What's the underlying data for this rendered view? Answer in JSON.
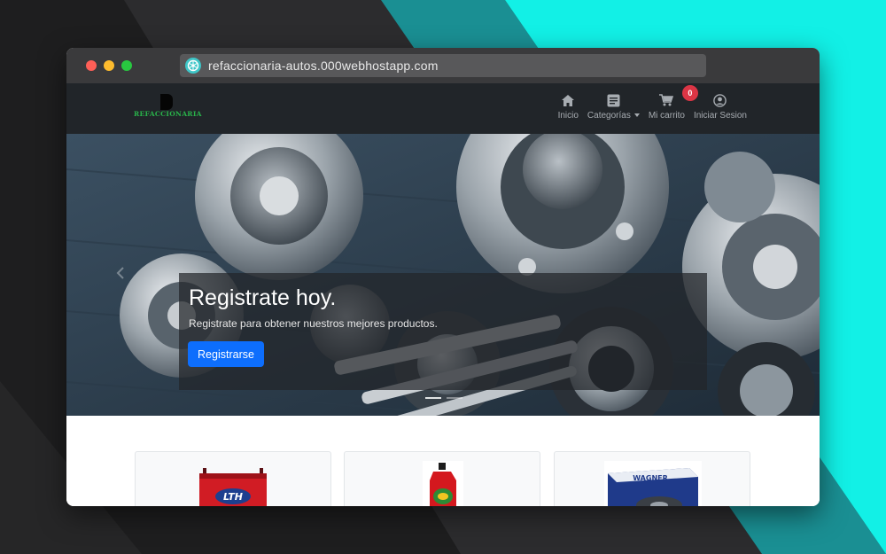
{
  "browser": {
    "url": "refaccionaria-autos.000webhostapp.com"
  },
  "site": {
    "logo_text": "REFACCIONARIA",
    "nav": [
      {
        "label": "Inicio",
        "icon": "home-icon"
      },
      {
        "label": "Categorías",
        "icon": "list-icon",
        "has_dropdown": true
      },
      {
        "label": "Mi carrito",
        "icon": "cart-icon",
        "badge": "0"
      },
      {
        "label": "Iniciar Sesion",
        "icon": "user-circle-icon"
      }
    ],
    "colors": {
      "navbar": "#212529",
      "primary_button": "#0d6efd",
      "badge": "#dc3545",
      "logo": "#29b34a"
    }
  },
  "hero": {
    "title": "Registrate hoy.",
    "subtitle": "Registrate para obtener nuestros mejores productos.",
    "button_label": "Registrarse",
    "slide_count": 2,
    "active_slide": 1
  },
  "products": [
    {
      "name": "battery",
      "label": "LTH"
    },
    {
      "name": "oil-bottle",
      "label": ""
    },
    {
      "name": "brake-pads-box",
      "label": "WAGNER"
    }
  ]
}
